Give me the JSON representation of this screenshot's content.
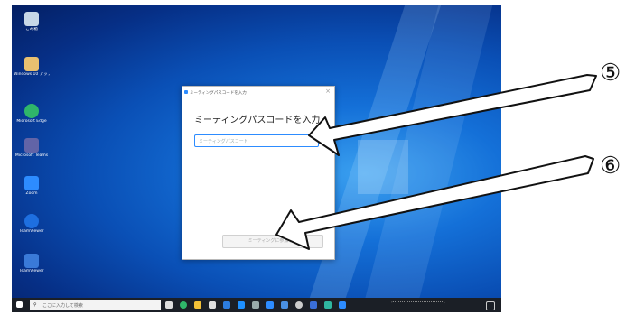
{
  "desktop": {
    "icons": [
      {
        "name": "recycle-bin",
        "label": "ごみ箱",
        "color": "#c7d8e8"
      },
      {
        "name": "app-shortcut",
        "label": "Windows 10 アップ",
        "color": "#e8c070"
      },
      {
        "name": "edge",
        "label": "Microsoft Edge",
        "color": "#2fb66a"
      },
      {
        "name": "teams",
        "label": "Microsoft Teams",
        "color": "#6264a7"
      },
      {
        "name": "zoom",
        "label": "Zoom",
        "color": "#2d8cff"
      },
      {
        "name": "teamviewer",
        "label": "TeamViewer",
        "color": "#1e6fe0"
      },
      {
        "name": "app-last",
        "label": "TeamViewer",
        "color": "#3a7ad8"
      }
    ]
  },
  "taskbar": {
    "search_placeholder": "ここに入力して検索"
  },
  "dialog": {
    "title": "ミーティングパスコードを入力",
    "heading": "ミーティングパスコードを入力",
    "close": "×",
    "input_placeholder": "ミーティングパスコード",
    "join_label": "ミーティングに参加する"
  },
  "annotations": {
    "step5": "⑤",
    "step6": "⑥"
  }
}
